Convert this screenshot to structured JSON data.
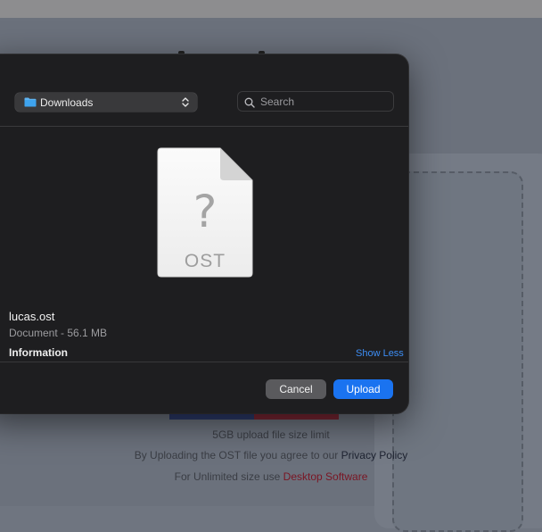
{
  "background": {
    "size_limit_text": "5GB upload file size limit",
    "agree_prefix": "By Uploading the OST file you agree to our ",
    "privacy_link": "Privacy Policy",
    "unlimited_prefix": "For Unlimited size use ",
    "desktop_link": "Desktop Software"
  },
  "dialog": {
    "location": {
      "label": "Downloads",
      "icon": "folder-icon"
    },
    "search": {
      "placeholder": "Search",
      "value": ""
    },
    "preview": {
      "file_extension": "OST",
      "placeholder_glyph": "?"
    },
    "file": {
      "name": "lucas.ost",
      "meta": "Document - 56.1 MB"
    },
    "info_heading": "Information",
    "show_less": "Show Less",
    "buttons": {
      "cancel": "Cancel",
      "upload": "Upload"
    }
  },
  "colors": {
    "accent_blue": "#1a73f0",
    "link_blue": "#3d8ef5",
    "dialog_bg": "#1e1e20",
    "desktop_link": "#7a1523"
  }
}
